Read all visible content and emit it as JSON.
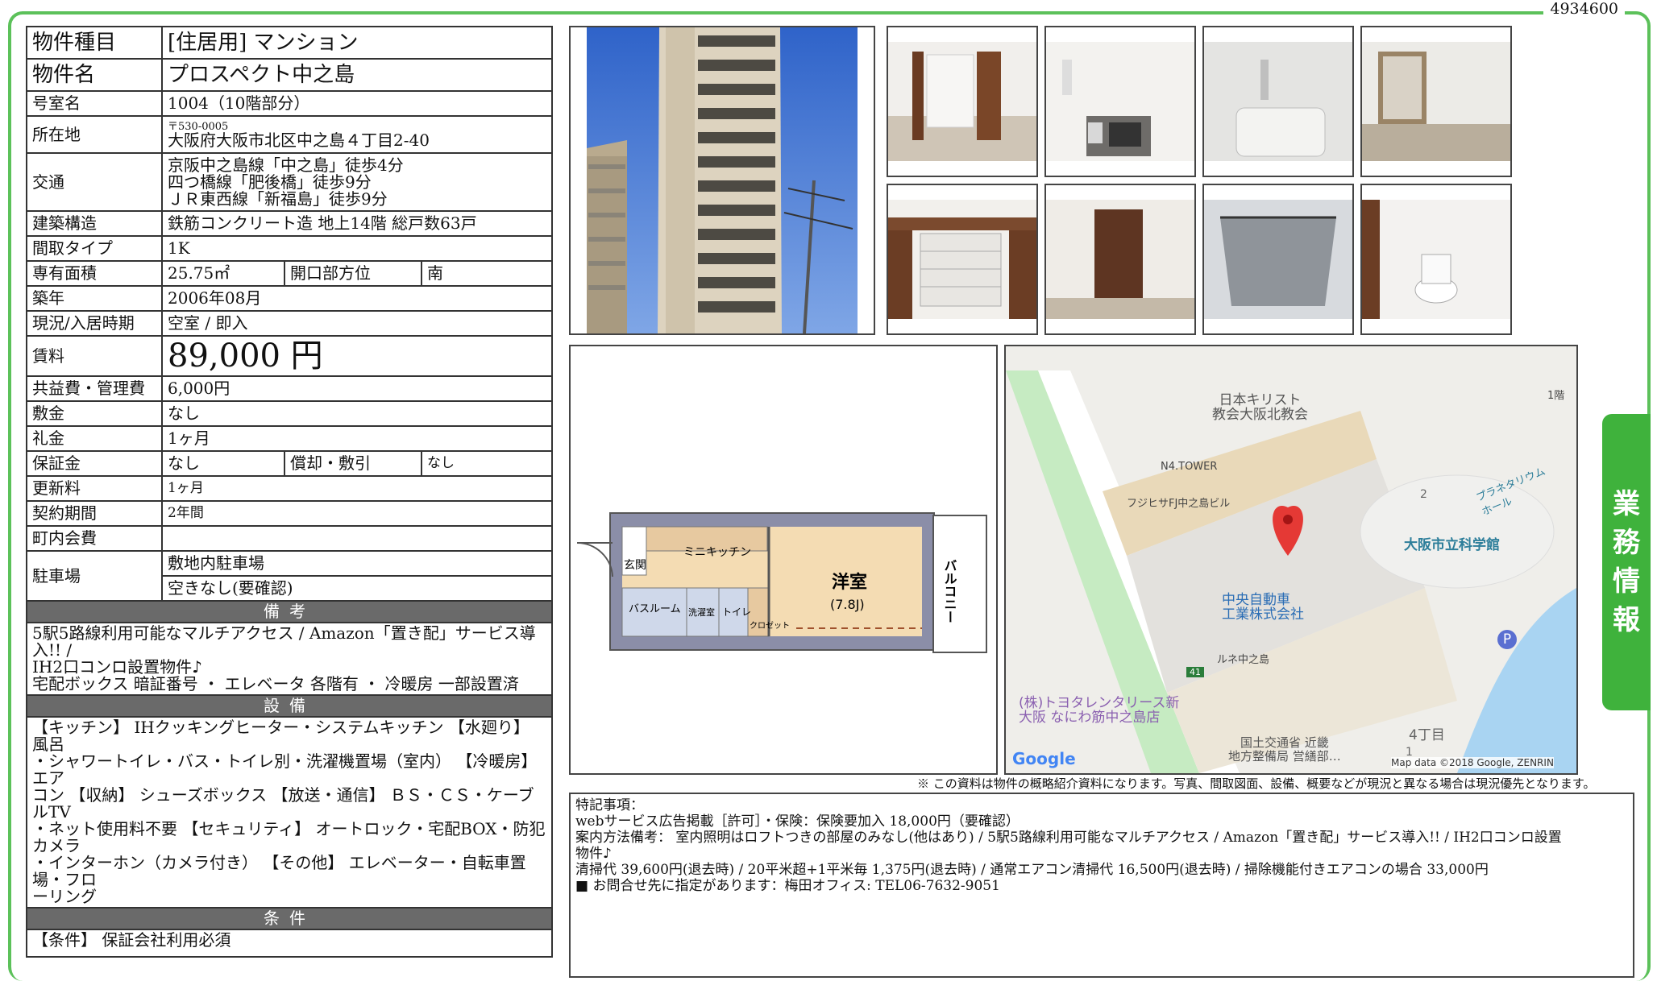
{
  "doc_id": "4934600",
  "side_tab": [
    "業",
    "務",
    "情",
    "報"
  ],
  "rows": {
    "type_label": "物件種目",
    "type_value": "[住居用]  マンション",
    "name_label": "物件名",
    "name_value": "プロスペクト中之島",
    "room_label": "号室名",
    "room_value": "1004（10階部分）",
    "addr_label": "所在地",
    "addr_zip": "〒530-0005",
    "addr_value": "大阪府大阪市北区中之島４丁目2-40",
    "traffic_label": "交通",
    "traffic_lines": [
      "京阪中之島線「中之島」徒歩4分",
      "四つ橋線「肥後橋」徒歩9分",
      "ＪＲ東西線「新福島」徒歩9分"
    ],
    "structure_label": "建築構造",
    "structure_value": "鉄筋コンクリート造  地上14階  総戸数63戸",
    "layout_label": "間取タイプ",
    "layout_value": "1K",
    "area_label": "専有面積",
    "area_value": "25.75㎡",
    "direction_label": "開口部方位",
    "direction_value": "南",
    "built_label": "築年",
    "built_value": "2006年08月",
    "status_label": "現況/入居時期",
    "status_value": "空室 /  即入",
    "rent_label": "賃料",
    "rent_value": "89,000 円",
    "fee_label": "共益費・管理費",
    "fee_value": "6,000円",
    "deposit_label": "敷金",
    "deposit_value": "なし",
    "key_label": "礼金",
    "key_value": "1ヶ月",
    "guarantee_label": "保証金",
    "guarantee_value": "なし",
    "amort_label": "償却・敷引",
    "amort_value": "なし",
    "renew_label": "更新料",
    "renew_value": "1ヶ月",
    "contract_label": "契約期間",
    "contract_value": "2年間",
    "town_label": "町内会費",
    "town_value": "",
    "parking_label": "駐車場",
    "parking_value1": "敷地内駐車場",
    "parking_value2": "空きなし(要確認)"
  },
  "bikou": {
    "header": "備考",
    "lines": [
      "5駅5路線利用可能なマルチアクセス / Amazon「置き配」サービス導入!! /",
      "IH2口コンロ設置物件♪",
      "宅配ボックス 暗証番号 ・ エレベータ 各階有 ・ 冷暖房 一部設置済"
    ]
  },
  "setsubi": {
    "header": "設備",
    "lines": [
      "【キッチン】 IHクッキングヒーター・システムキッチン 【水廻り】 風呂",
      "・シャワートイレ・バス・トイレ別・洗濯機置場（室内） 【冷暖房】 エア",
      "コン 【収納】 シューズボックス 【放送・通信】 ＢＳ・ＣＳ・ケーブルTV",
      "・ネット使用料不要 【セキュリティ】 オートロック・宅配BOX・防犯カメラ",
      "・インターホン（カメラ付き） 【その他】 エレベーター・自転車置場・フロ",
      "ーリング"
    ]
  },
  "jouken": {
    "header": "条件",
    "text": "【条件】 保証会社利用必須"
  },
  "floorplan": {
    "genkan": "玄関",
    "kitchen": "ミニキッチン",
    "bath": "バスルーム",
    "wash": "洗濯室",
    "toilet": "トイレ",
    "closet": "クロゼット",
    "room": "洋室",
    "room_size": "(7.8J)",
    "balcony": "バルコニー"
  },
  "map": {
    "labels": {
      "church": "日本キリスト\n教会大阪北教会",
      "n4": "N4.TOWER",
      "fujisawa": "フジヒサFJ中之島ビル",
      "science": "大阪市立科学館",
      "planetarium": "プラネタリウム\nホール",
      "chuo": "中央自動車\n工業株式会社",
      "rune": "ルネ中之島",
      "toyota": "(株)トヨタレンタリース新\n大阪 なにわ筋中之島店",
      "kokudo": "国土交通省 近畿\n地方整備局 営繕部…",
      "chome": "4丁目",
      "floor1": "1階",
      "num2": "2",
      "num1": "1",
      "route": "41",
      "p": "P",
      "google": "Google",
      "mapdata": "Map data ©2018 Google, ZENRIN"
    }
  },
  "disclaimer": "※ この資料は物件の概略紹介資料になります。写真、間取図面、設備、概要などが現況と異なる場合は現況優先となります。",
  "remarks": {
    "title": "特記事項：",
    "lines": [
      "webサービス広告掲載［許可］・保険：保険要加入 18,000円（要確認）",
      "案内方法備考： 室内照明はロフトつきの部屋のみなし(他はあり) / 5駅5路線利用可能なマルチアクセス / Amazon「置き配」サービス導入!! / IH2口コンロ設置",
      "物件♪",
      "清掃代 39,600円(退去時) / 20平米超+1平米毎 1,375円(退去時) / 通常エアコン清掃代 16,500円(退去時) / 掃除機能付きエアコンの場合 33,000円",
      "■ お問合せ先に指定があります：梅田オフィス: TEL06-7632-9051"
    ]
  }
}
